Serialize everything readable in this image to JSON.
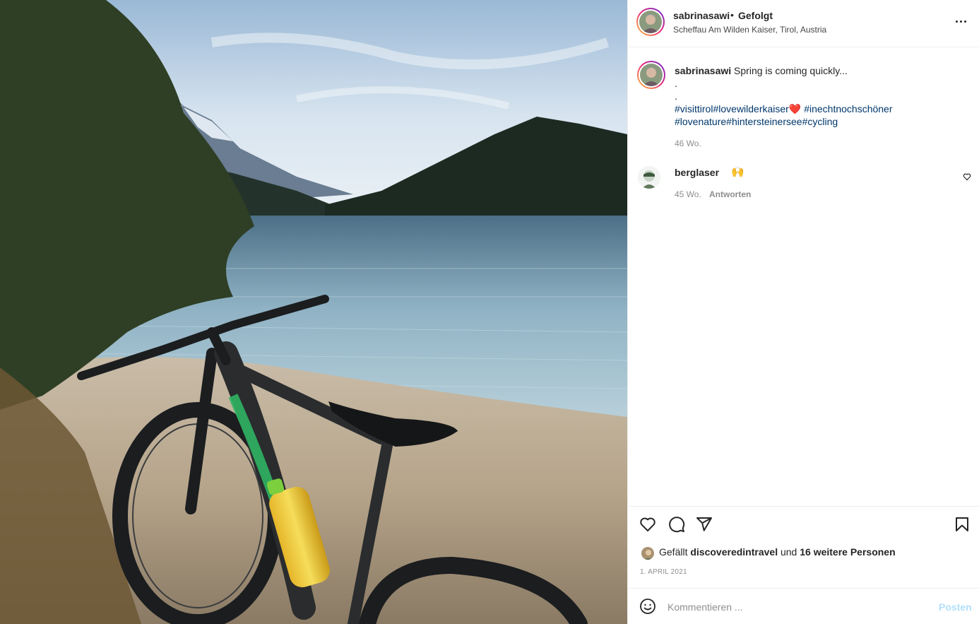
{
  "post": {
    "username": "sabrinasawi",
    "separator": "•",
    "follow_status": "Gefolgt",
    "location": "Scheffau Am Wilden Kaiser, Tirol, Austria",
    "photo_icon": "lake-mountain-bicycle-photo"
  },
  "caption": {
    "username": "sabrinasawi",
    "text": "Spring is coming quickly...",
    "dot1": ".",
    "dot2": ".",
    "tag1": "#visittirol",
    "tag2": "#lovewilderkaiser",
    "heart": "❤️",
    "tag3": "#inechtnochschöner",
    "tag4": "#lovenature",
    "tag5": "#hintersteinersee",
    "tag6": "#cycling",
    "time": "46 Wo."
  },
  "comments": [
    {
      "username": "berglaser",
      "text": "🙌",
      "time": "45 Wo.",
      "reply_label": "Antworten"
    }
  ],
  "actions": {
    "like_icon": "heart-icon",
    "comment_icon": "comment-icon",
    "share_icon": "paper-plane-icon",
    "save_icon": "bookmark-icon"
  },
  "likes": {
    "prefix": "Gefällt",
    "user": "discoveredintravel",
    "middle": "und",
    "others": "16 weitere Personen"
  },
  "date": "1. April 2021",
  "comment_box": {
    "placeholder": "Kommentieren ...",
    "post_label": "Posten",
    "emoji_icon": "smiley-icon"
  },
  "colors": {
    "link": "#00376b",
    "muted": "#8e8e8e",
    "post_disabled": "#b2dffc",
    "heart": "#e0152c"
  }
}
